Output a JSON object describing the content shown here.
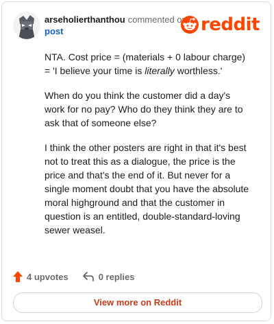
{
  "comment": {
    "username": "arseholierthanthou",
    "action": "commented on",
    "post_link": "post",
    "body_prefix": "NTA. Cost price = (materials + 0 labour charge) = 'I believe your time is ",
    "body_emphasis": "literally",
    "body_suffix": " worthless.'",
    "paragraph_2": "When do you think the customer did a day's work for no pay? Who do they think they are to ask that of someone else?",
    "paragraph_3": "I think the other posters are right in that it's best not to treat this as a dialogue, the price is the price and that's the end of it. But never for a single moment doubt that you have the absolute moral highground and that the customer in question is an entitled, double-standard-loving sewer weasel."
  },
  "brand": {
    "wordmark": "reddit",
    "icon": "reddit-logo-icon",
    "color": "#ff4500"
  },
  "footer": {
    "upvotes_label": "4 upvotes",
    "replies_label": "0 replies",
    "upvote_icon": "upvote-arrow-icon",
    "reply_icon": "reply-arrow-icon",
    "upvote_color": "#ff4500"
  },
  "view_more": {
    "label": "View more on Reddit"
  }
}
